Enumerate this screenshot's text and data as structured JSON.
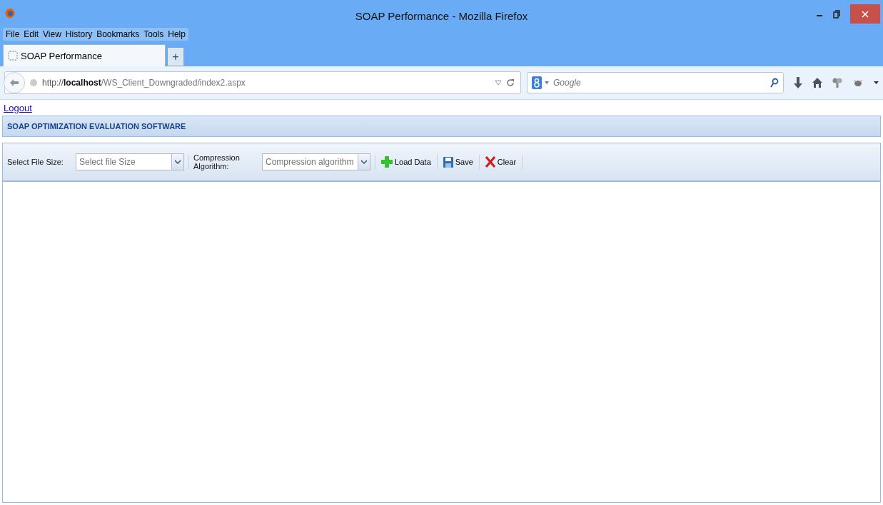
{
  "window": {
    "title": "SOAP Performance - Mozilla Firefox"
  },
  "menu": [
    "File",
    "Edit",
    "View",
    "History",
    "Bookmarks",
    "Tools",
    "Help"
  ],
  "tabs": [
    {
      "label": "SOAP Performance",
      "selected": true
    }
  ],
  "new_tab": "+",
  "address": {
    "prefix": "http://",
    "host": "localhost",
    "path": "/WS_Client_Downgraded/index2.aspx"
  },
  "search": {
    "placeholder": "Google"
  },
  "page": {
    "logout": "Logout",
    "panel_title": "SOAP OPTIMIZATION EVALUATION SOFTWARE",
    "toolbar": [
      {
        "kind": "label",
        "text": "Select File Size:"
      },
      {
        "kind": "select",
        "placeholder": "Select file Size"
      },
      {
        "kind": "label",
        "text": "Compression Algorithm:"
      },
      {
        "kind": "select",
        "placeholder": "Compression algorithm"
      },
      {
        "kind": "add",
        "text": "Load Data"
      },
      {
        "kind": "save",
        "text": "Save"
      },
      {
        "kind": "clear",
        "text": "Clear"
      }
    ]
  }
}
